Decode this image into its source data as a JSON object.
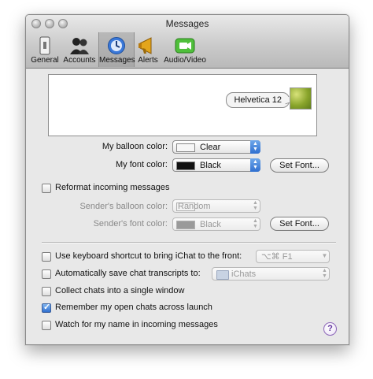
{
  "window": {
    "title": "Messages"
  },
  "toolbar": {
    "items": [
      {
        "label": "General",
        "icon": "general-switch-icon",
        "selected": false
      },
      {
        "label": "Accounts",
        "icon": "accounts-people-icon",
        "selected": false
      },
      {
        "label": "Messages",
        "icon": "messages-clock-icon",
        "selected": true
      },
      {
        "label": "Alerts",
        "icon": "alerts-megaphone-icon",
        "selected": false
      },
      {
        "label": "Audio/Video",
        "icon": "audio-video-camera-icon",
        "selected": false
      }
    ]
  },
  "preview": {
    "balloon_text": "Helvetica 12"
  },
  "my_settings": {
    "balloon_color_label": "My balloon color:",
    "balloon_color_value": "Clear",
    "font_color_label": "My font color:",
    "font_color_value": "Black",
    "set_font_button": "Set Font..."
  },
  "reformat": {
    "checkbox_label": "Reformat incoming messages",
    "checked": false,
    "sender_balloon_label": "Sender's balloon color:",
    "sender_balloon_value": "Random",
    "sender_font_label": "Sender's font color:",
    "sender_font_value": "Black",
    "set_font_button": "Set Font..."
  },
  "options": {
    "keyboard_shortcut": {
      "label": "Use keyboard shortcut to bring iChat to the front:",
      "checked": false,
      "value": "⌥⌘ F1"
    },
    "save_transcripts": {
      "label": "Automatically save chat transcripts to:",
      "checked": false,
      "value": "iChats"
    },
    "collect_chats": {
      "label": "Collect chats into a single window",
      "checked": false
    },
    "remember_open": {
      "label": "Remember my open chats across launch",
      "checked": true
    },
    "watch_name": {
      "label": "Watch for my name in incoming messages",
      "checked": false
    }
  },
  "help": {
    "label": "?"
  },
  "colors": {
    "selection_blue": "#2f6fd0",
    "window_bg": "#e8e8e8"
  }
}
